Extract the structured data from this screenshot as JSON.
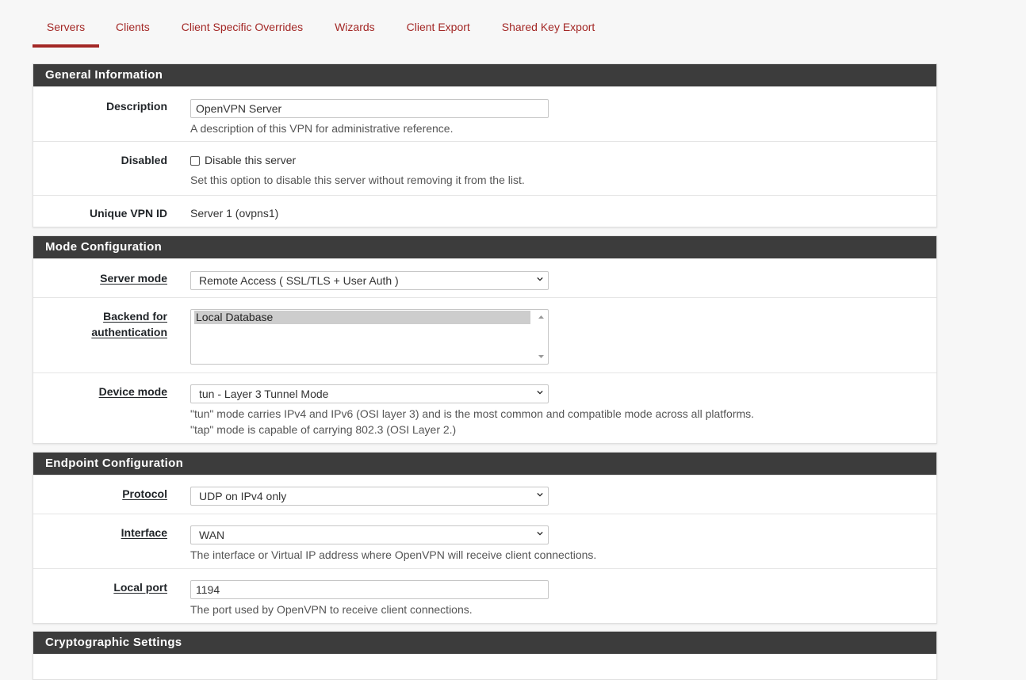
{
  "tabs": [
    {
      "label": "Servers",
      "active": true
    },
    {
      "label": "Clients"
    },
    {
      "label": "Client Specific Overrides"
    },
    {
      "label": "Wizards"
    },
    {
      "label": "Client Export"
    },
    {
      "label": "Shared Key Export"
    }
  ],
  "general": {
    "title": "General Information",
    "description": {
      "label": "Description",
      "value": "OpenVPN Server",
      "help": "A description of this VPN for administrative reference."
    },
    "disabled": {
      "label": "Disabled",
      "checkbox_label": "Disable this server",
      "checked": false,
      "help": "Set this option to disable this server without removing it from the list."
    },
    "vpn_id": {
      "label": "Unique VPN ID",
      "value": "Server 1 (ovpns1)"
    }
  },
  "mode": {
    "title": "Mode Configuration",
    "server_mode": {
      "label": "Server mode",
      "value": "Remote Access ( SSL/TLS + User Auth )"
    },
    "backend": {
      "label_line1": "Backend for",
      "label_line2": "authentication",
      "selected": "Local Database"
    },
    "device_mode": {
      "label": "Device mode",
      "value": "tun - Layer 3 Tunnel Mode",
      "help1": "\"tun\" mode carries IPv4 and IPv6 (OSI layer 3) and is the most common and compatible mode across all platforms.",
      "help2": "\"tap\" mode is capable of carrying 802.3 (OSI Layer 2.)"
    }
  },
  "endpoint": {
    "title": "Endpoint Configuration",
    "protocol": {
      "label": "Protocol",
      "value": "UDP on IPv4 only"
    },
    "interface": {
      "label": "Interface",
      "value": "WAN",
      "help": "The interface or Virtual IP address where OpenVPN will receive client connections."
    },
    "local_port": {
      "label": "Local port",
      "value": "1194",
      "help": "The port used by OpenVPN to receive client connections."
    }
  },
  "crypto": {
    "title": "Cryptographic Settings"
  },
  "colors": {
    "accent": "#a32826",
    "panel_header": "#3c3c3c"
  }
}
